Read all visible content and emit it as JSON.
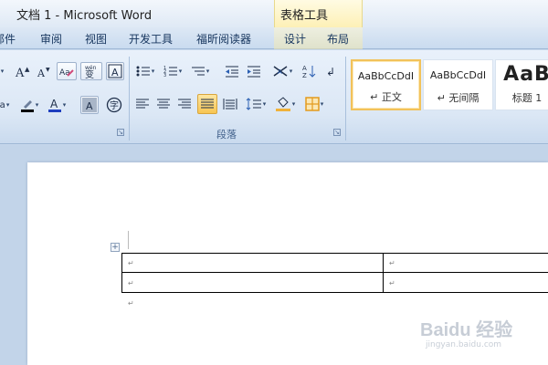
{
  "window": {
    "title": "文档 1 - Microsoft Word",
    "context_header": "表格工具"
  },
  "tabs": [
    {
      "label": "邮件"
    },
    {
      "label": "审阅"
    },
    {
      "label": "视图"
    },
    {
      "label": "开发工具"
    },
    {
      "label": "福昕阅读器"
    },
    {
      "label": "设计"
    },
    {
      "label": "布局"
    }
  ],
  "font_group": {
    "text_effect_label": "A"
  },
  "paragraph_group": {
    "label": "段落",
    "sort_label": "A↓Z"
  },
  "styles_gallery": [
    {
      "sample": "AaBbCcDdI",
      "name": "↵ 正文",
      "selected": true
    },
    {
      "sample": "AaBbCcDdI",
      "name": "↵ 无间隔",
      "selected": false
    },
    {
      "sample": "AaB",
      "name": "标题 1",
      "selected": false
    }
  ],
  "document": {
    "paragraph_mark": "↵",
    "table_move_handle": "+",
    "table_rows": 2,
    "table_cols": 2
  },
  "watermark": {
    "text": "Baidu 经验",
    "sub": "jingyan.baidu.com"
  },
  "colors": {
    "highlight": "#f7c552",
    "font_color": "#1f3fbf",
    "shading": "#f0b23a"
  }
}
